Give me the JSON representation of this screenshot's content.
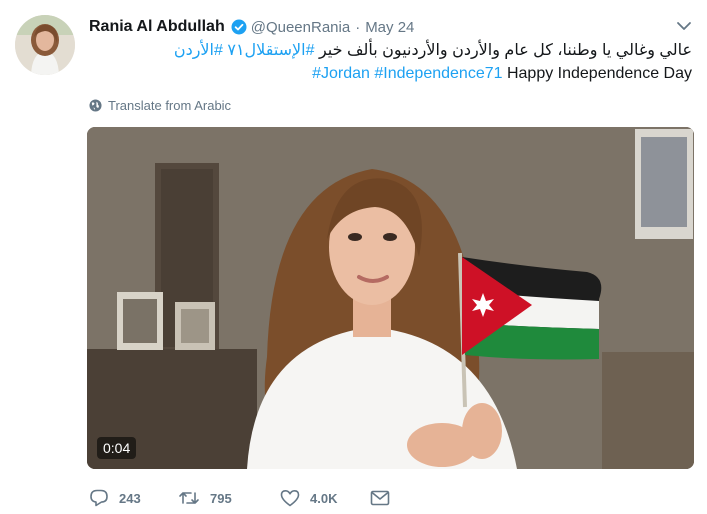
{
  "tweet": {
    "author_name": "Rania Al Abdullah",
    "handle": "@QueenRania",
    "separator": "·",
    "date": "May 24",
    "arabic_text": "عالي وغالي يا وطننا، كل عام والأردن والأردنيون بألف خير",
    "arabic_hashtags": [
      "#الإستقلال٧١",
      "#الأردن"
    ],
    "hashtags": [
      "#Jordan",
      "#Independence71"
    ],
    "english_text": "Happy Independence Day",
    "translate_label": "Translate from Arabic",
    "video_duration": "0:04",
    "stats": {
      "replies": "243",
      "retweets": "795",
      "likes": "4.0K"
    }
  },
  "colors": {
    "accent": "#1da1f2",
    "muted": "#657786",
    "verified": "#1da1f2"
  },
  "icons": [
    "verified-badge-icon",
    "chevron-down-icon",
    "globe-icon",
    "reply-icon",
    "retweet-icon",
    "like-icon",
    "message-icon"
  ]
}
